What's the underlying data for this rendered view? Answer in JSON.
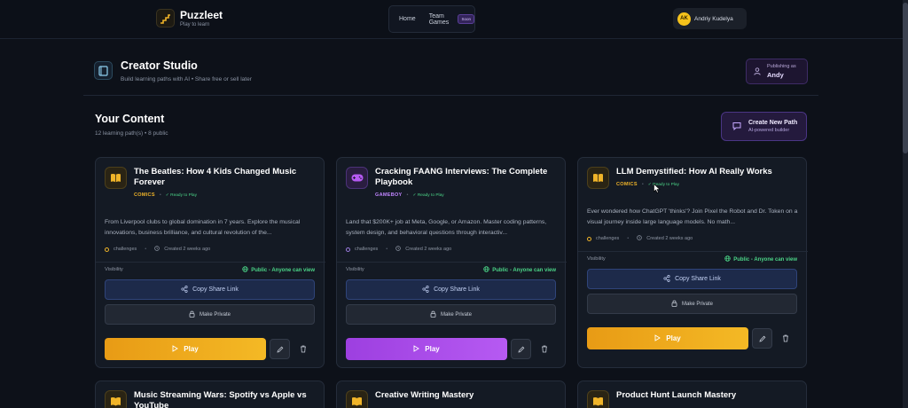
{
  "nav": {
    "brand": "Puzzleet",
    "tagline": "Play to learn",
    "home": "Home",
    "team_games": "Team Games",
    "soon": "Soon",
    "user_initials": "AK",
    "user_name": "Andriy Kudelya"
  },
  "studio": {
    "title": "Creator Studio",
    "subtitle": "Build learning paths with AI • Share free or sell later",
    "publishing_label": "Publishing as",
    "publishing_name": "Andy"
  },
  "content": {
    "title": "Your Content",
    "subtitle": "12 learning path(s) • 8 public",
    "create_title": "Create New Path",
    "create_sub": "AI-powered builder"
  },
  "cards": [
    {
      "title": "The Beatles: How 4 Kids Changed Music Forever",
      "tag": "COMICS",
      "status": "✓ Ready to Play",
      "description": "From Liverpool clubs to global domination in 7 years. Explore the musical innovations, business brilliance, and cultural revolution of the...",
      "meta_type": "challenges",
      "meta_created": "Created 2 weeks ago",
      "visibility_label": "Visibility",
      "visibility_value": "Public - Anyone can view",
      "share_label": "Copy Share Link",
      "private_label": "Make Private",
      "play_label": "Play"
    },
    {
      "title": "Cracking FAANG Interviews: The Complete Playbook",
      "tag": "GAMEBOY",
      "status": "✓ Ready to Play",
      "description": "Land that $200K+ job at Meta, Google, or Amazon. Master coding patterns, system design, and behavioral questions through interactiv...",
      "meta_type": "challenges",
      "meta_created": "Created 2 weeks ago",
      "visibility_label": "Visibility",
      "visibility_value": "Public - Anyone can view",
      "share_label": "Copy Share Link",
      "private_label": "Make Private",
      "play_label": "Play"
    },
    {
      "title": "LLM Demystified: How AI Really Works",
      "tag": "COMICS",
      "status": "✓ Ready to Play",
      "description": "Ever wondered how ChatGPT 'thinks'? Join Pixel the Robot and Dr. Token on a visual journey inside large language models. No math...",
      "meta_type": "challenges",
      "meta_created": "Created 2 weeks ago",
      "visibility_label": "Visibility",
      "visibility_value": "Public - Anyone can view",
      "share_label": "Copy Share Link",
      "private_label": "Make Private",
      "play_label": "Play"
    },
    {
      "title": "Music Streaming Wars: Spotify vs Apple vs YouTube"
    },
    {
      "title": "Creative Writing Mastery"
    },
    {
      "title": "Product Hunt Launch Mastery"
    }
  ],
  "colors": {
    "background": "#0d1119",
    "comics_accent": "#f0b429",
    "gameboy_accent": "#b65af2",
    "public_green": "#4bd487"
  }
}
